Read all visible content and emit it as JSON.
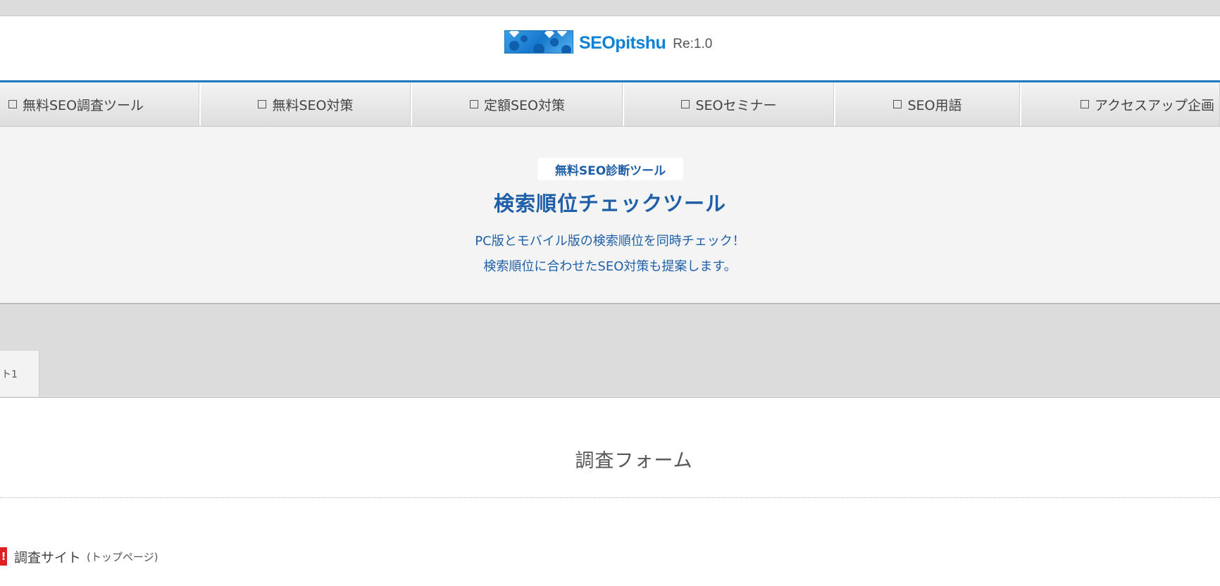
{
  "header": {
    "logo_text": "SEOpitshu",
    "version": "Re:1.0",
    "brand_color": "#0d82d6"
  },
  "nav": {
    "items": [
      {
        "label": "無料SEO調査ツール"
      },
      {
        "label": "無料SEO対策"
      },
      {
        "label": "定額SEO対策"
      },
      {
        "label": "SEOセミナー"
      },
      {
        "label": "SEO用語"
      },
      {
        "label": "アクセスアップ企画"
      }
    ]
  },
  "hero": {
    "badge": "無料SEO診断ツール",
    "title": "検索順位チェックツール",
    "line1": "PC版とモバイル版の検索順位を同時チェック！",
    "line2": "検索順位に合わせたSEO対策も提案します。",
    "accent_color": "#1f5fa8"
  },
  "tabs": {
    "tab1_label": "ト1"
  },
  "form": {
    "title": "調査フォーム",
    "site_label": "調査サイト",
    "site_note": "(トップページ)",
    "required_mark": "!"
  }
}
